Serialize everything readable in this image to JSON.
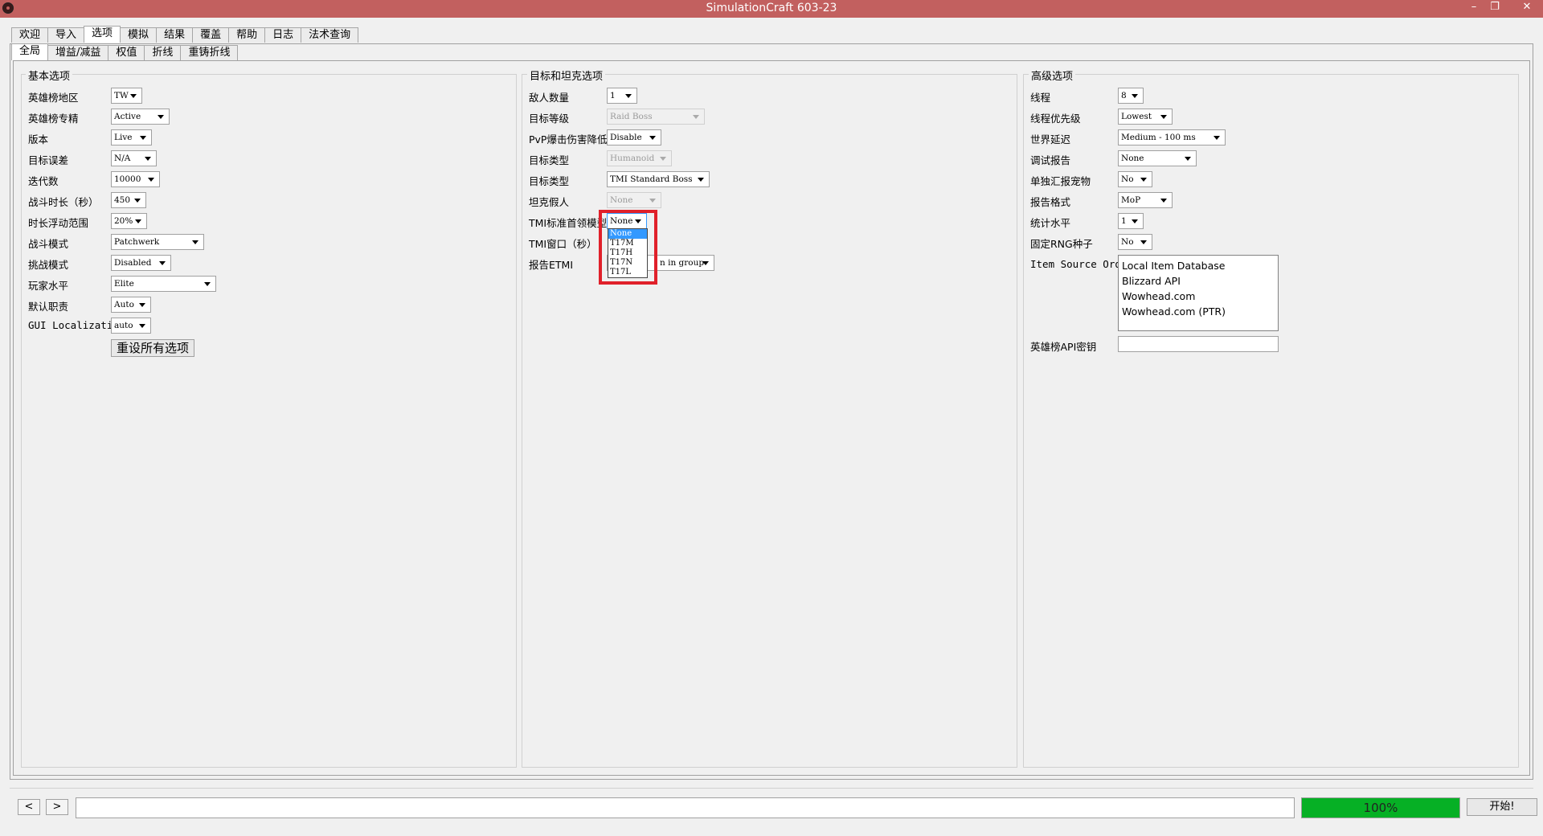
{
  "window": {
    "title": "SimulationCraft 603-23",
    "min": "–",
    "restore": "❐",
    "close": "✕"
  },
  "main_tabs": [
    "欢迎",
    "导入",
    "选项",
    "模拟",
    "结果",
    "覆盖",
    "帮助",
    "日志",
    "法术查询"
  ],
  "main_tab_active": 2,
  "sub_tabs": [
    "全局",
    "增益/减益",
    "权值",
    "折线",
    "重铸折线"
  ],
  "sub_tab_active": 0,
  "basic": {
    "title": "基本选项",
    "rows": [
      {
        "label": "英雄榜地区",
        "value": "TW"
      },
      {
        "label": "英雄榜专精",
        "value": "Active"
      },
      {
        "label": "版本",
        "value": "Live"
      },
      {
        "label": "目标误差",
        "value": "N/A"
      },
      {
        "label": "迭代数",
        "value": "10000"
      },
      {
        "label": "战斗时长（秒）",
        "value": "450"
      },
      {
        "label": "时长浮动范围",
        "value": "20%"
      },
      {
        "label": "战斗模式",
        "value": "Patchwerk"
      },
      {
        "label": "挑战模式",
        "value": "Disabled"
      },
      {
        "label": "玩家水平",
        "value": "Elite"
      },
      {
        "label": "默认职责",
        "value": "Auto"
      },
      {
        "label": "GUI Localization",
        "value": "auto"
      }
    ],
    "reset_label": "重设所有选项"
  },
  "target": {
    "title": "目标和坦克选项",
    "rows": [
      {
        "label": "敌人数量",
        "value": "1"
      },
      {
        "label": "目标等级",
        "value": "Raid Boss"
      },
      {
        "label": "PvP爆击伤害降低",
        "value": "Disable"
      },
      {
        "label": "目标类型",
        "value": "Humanoid"
      },
      {
        "label": "目标类型",
        "value": "TMI Standard Boss"
      },
      {
        "label": "坦克假人",
        "value": "None"
      },
      {
        "label": "TMI标准首领模型",
        "value": "None"
      },
      {
        "label": "TMI窗口（秒）",
        "value": ""
      },
      {
        "label": "报告ETMI",
        "value": "n in group"
      }
    ],
    "popup_options": [
      "None",
      "T17M",
      "T17H",
      "T17N",
      "T17L"
    ]
  },
  "advanced": {
    "title": "高级选项",
    "rows": [
      {
        "label": "线程",
        "value": "8"
      },
      {
        "label": "线程优先级",
        "value": "Lowest"
      },
      {
        "label": "世界延迟",
        "value": "Medium - 100 ms"
      },
      {
        "label": "调试报告",
        "value": "None"
      },
      {
        "label": "单独汇报宠物",
        "value": "No"
      },
      {
        "label": "报告格式",
        "value": "MoP"
      },
      {
        "label": "统计水平",
        "value": "1"
      },
      {
        "label": "固定RNG种子",
        "value": "No"
      }
    ],
    "item_source_label": "Item Source Order",
    "item_sources": [
      "Local Item Database",
      "Blizzard API",
      "Wowhead.com",
      "Wowhead.com (PTR)"
    ],
    "api_key_label": "英雄榜API密钥"
  },
  "bottom": {
    "back": "<",
    "forward": ">",
    "progress_text": "100%",
    "progress_value": 1.0,
    "start_label": "开始!"
  }
}
